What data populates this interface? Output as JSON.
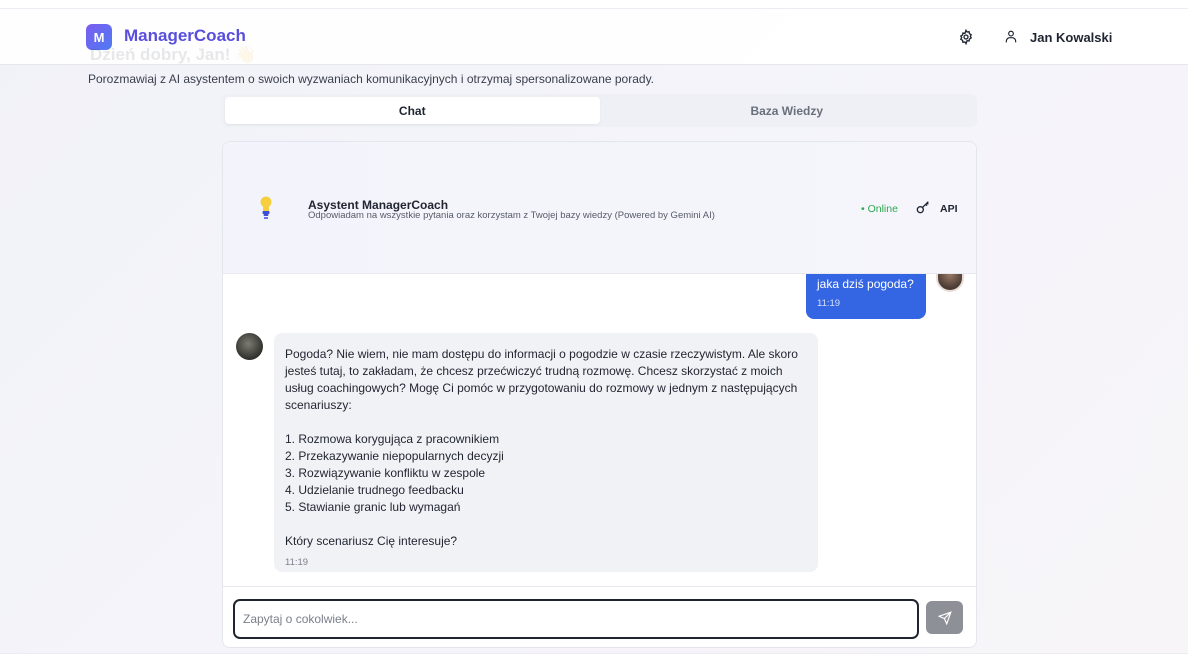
{
  "app": {
    "logo_letter": "M",
    "name": "ManagerCoach",
    "greeting_faded": "Dzień dobry, Jan! 👋",
    "user_name": "Jan Kowalski"
  },
  "intro": "Porozmawiaj z AI asystentem o swoich wyzwaniach komunikacyjnych i otrzymaj spersonalizowane porady.",
  "tabs": [
    {
      "label": "Chat",
      "active": true
    },
    {
      "label": "Baza Wiedzy",
      "active": false
    }
  ],
  "assistant": {
    "title": "Asystent ManagerCoach",
    "subtitle": "Odpowiadam na wszystkie pytania oraz korzystam z Twojej bazy wiedzy (Powered by Gemini AI)",
    "status": "• Online",
    "api_label": "API"
  },
  "messages": {
    "user": {
      "text": "jaka dziś pogoda?",
      "time": "11:19"
    },
    "ai": {
      "p1": "Pogoda?  Nie wiem, nie mam dostępu do informacji o pogodzie w czasie rzeczywistym.  Ale skoro jesteś tutaj, to zakładam, że chcesz przećwiczyć trudną rozmowę.  Chcesz skorzystać z moich usług coachingowych?  Mogę Ci pomóc w przygotowaniu do rozmowy w jednym z następujących scenariuszy:",
      "list": [
        "1. Rozmowa korygująca z pracownikiem",
        "2. Przekazywanie niepopularnych decyzji",
        "3. Rozwiązywanie konfliktu w zespole",
        "4. Udzielanie trudnego feedbacku",
        "5. Stawianie granic lub wymagań"
      ],
      "question": "Który scenariusz Cię interesuje?",
      "time": "11:19"
    }
  },
  "input": {
    "placeholder": "Zapytaj o cokolwiek...",
    "value": ""
  },
  "colors": {
    "accent": "#5a4fdc",
    "user_bubble": "#3466e4",
    "online": "#2fa84f"
  }
}
